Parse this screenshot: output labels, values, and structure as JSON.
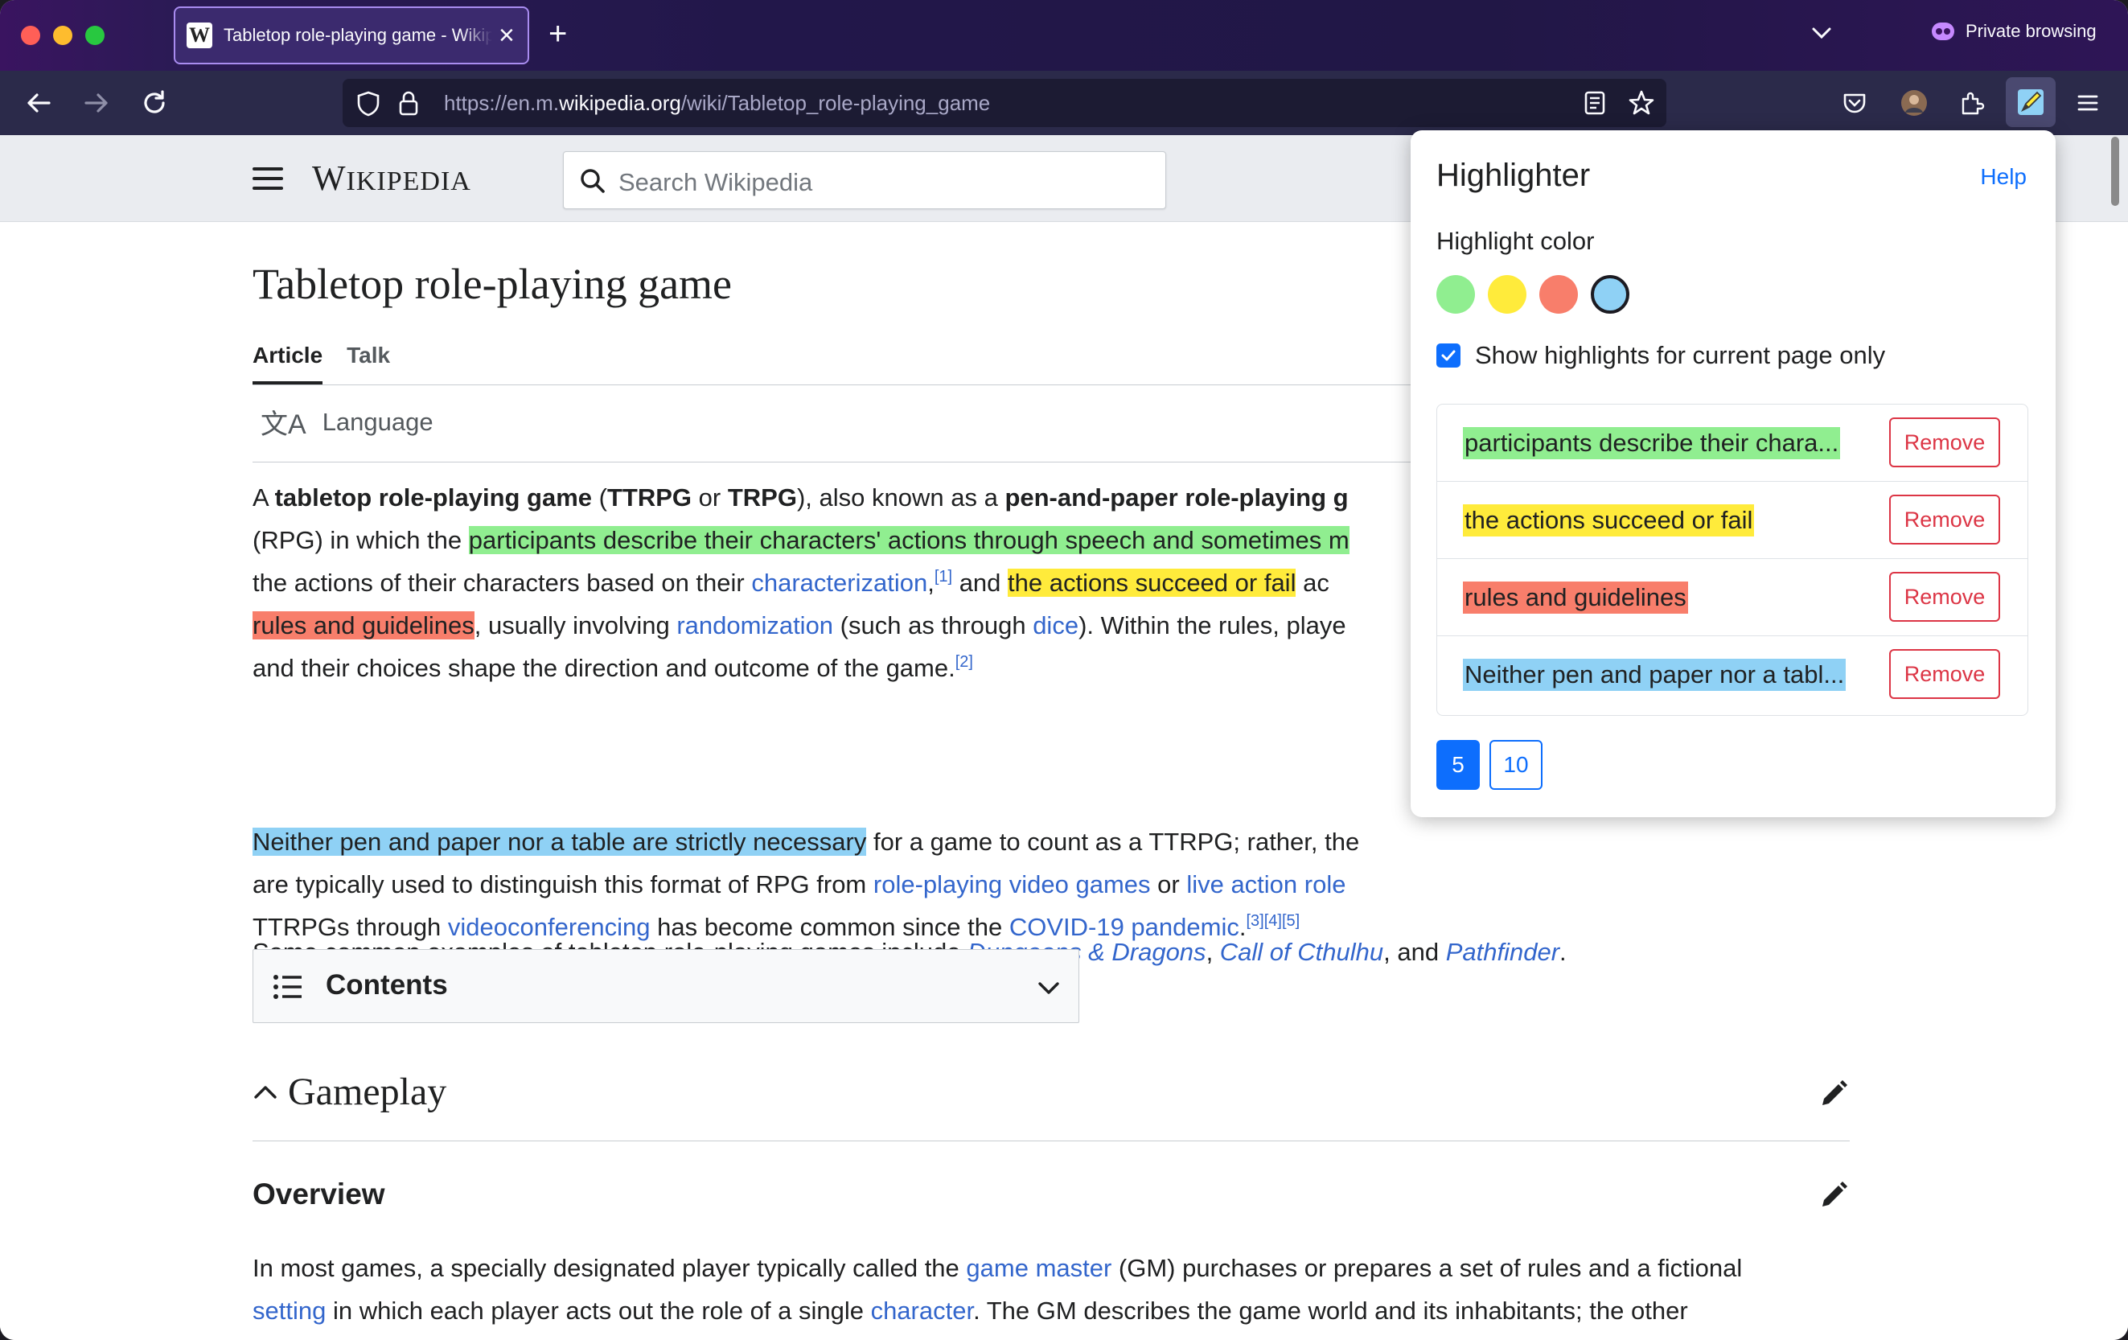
{
  "browser": {
    "tab_title": "Tabletop role-playing game - Wikipedia",
    "new_tab_label": "+",
    "private_label": "Private browsing",
    "url_prefix": "https://en.m.",
    "url_domain": "wikipedia.org",
    "url_path": "/wiki/Tabletop_role-playing_game"
  },
  "wiki": {
    "logo": "Wikipedia",
    "search_placeholder": "Search Wikipedia",
    "title": "Tabletop role-playing game",
    "tab_article": "Article",
    "tab_talk": "Talk",
    "language": "Language",
    "p1": {
      "l1_a": "A ",
      "l1_b": "tabletop role-playing game",
      "l1_c": " (",
      "l1_d": "TTRPG",
      "l1_e": " or ",
      "l1_f": "TRPG",
      "l1_g": "), also known as a ",
      "l1_h": "pen-and-paper role-playing g",
      "l2_a": "(RPG) in which the ",
      "l2_hl": "participants describe their characters' actions through speech and sometimes m",
      "l3_a": "the actions of their characters based on their ",
      "l3_link": "characterization",
      "l3_b": ",",
      "l3_sup": "[1]",
      "l3_c": " and ",
      "l3_hl": "the actions succeed or fail",
      "l3_d": " ac",
      "l4_hl": "rules and guidelines",
      "l4_a": ", usually involving ",
      "l4_link1": "randomization",
      "l4_b": " (such as through ",
      "l4_link2": "dice",
      "l4_c": "). Within the rules, playe",
      "l5_a": "and their choices shape the direction and outcome of the game.",
      "l5_sup": "[2]"
    },
    "p2": {
      "l1_hl": "Neither pen and paper nor a table are strictly necessary",
      "l1_a": " for a game to count as a TTRPG; rather, the",
      "l2_a": "are typically used to distinguish this format of RPG from ",
      "l2_link1": "role-playing video games",
      "l2_b": " or ",
      "l2_link2": "live action role",
      "l3_a": "TTRPGs through ",
      "l3_link1": "videoconferencing",
      "l3_b": " has become common since the ",
      "l3_link2": "COVID-19 pandemic",
      "l3_c": ".",
      "l3_sup": "[3][4][5]"
    },
    "p3": {
      "a": "Some common examples of tabletop role-playing games include ",
      "link1": "Dungeons & Dragons",
      "b": ", ",
      "link2": "Call of Cthulhu",
      "c": ", and ",
      "link3": "Pathfinder",
      "d": "."
    },
    "contents": "Contents",
    "section_gameplay": "Gameplay",
    "section_overview": "Overview",
    "p4": {
      "l1_a": "In most games, a specially designated player typically called the ",
      "l1_link": "game master",
      "l1_b": " (GM) purchases or prepares a set of rules and a fictional",
      "l2_link1": "setting",
      "l2_a": " in which each player acts out the role of a single ",
      "l2_link2": "character",
      "l2_b": ". The GM describes the game world and its inhabitants; the other"
    }
  },
  "highlighter": {
    "title": "Highlighter",
    "help": "Help",
    "color_label": "Highlight color",
    "colors": [
      "#90ee90",
      "#ffeb3b",
      "#f87e6b",
      "#8fd1f5"
    ],
    "selected_color": "#8fd1f5",
    "current_page_only_label": "Show highlights for current page only",
    "current_page_only": true,
    "items": [
      {
        "text": "participants describe their chara...",
        "color": "#90ee90",
        "remove": "Remove"
      },
      {
        "text": "the actions succeed or fail",
        "color": "#ffeb3b",
        "remove": "Remove"
      },
      {
        "text": "rules and guidelines",
        "color": "#f87e6b",
        "remove": "Remove"
      },
      {
        "text": "Neither pen and paper nor a tabl...",
        "color": "#8fd1f5",
        "remove": "Remove"
      }
    ],
    "page_sizes": [
      "5",
      "10"
    ],
    "active_page_size": "5"
  }
}
